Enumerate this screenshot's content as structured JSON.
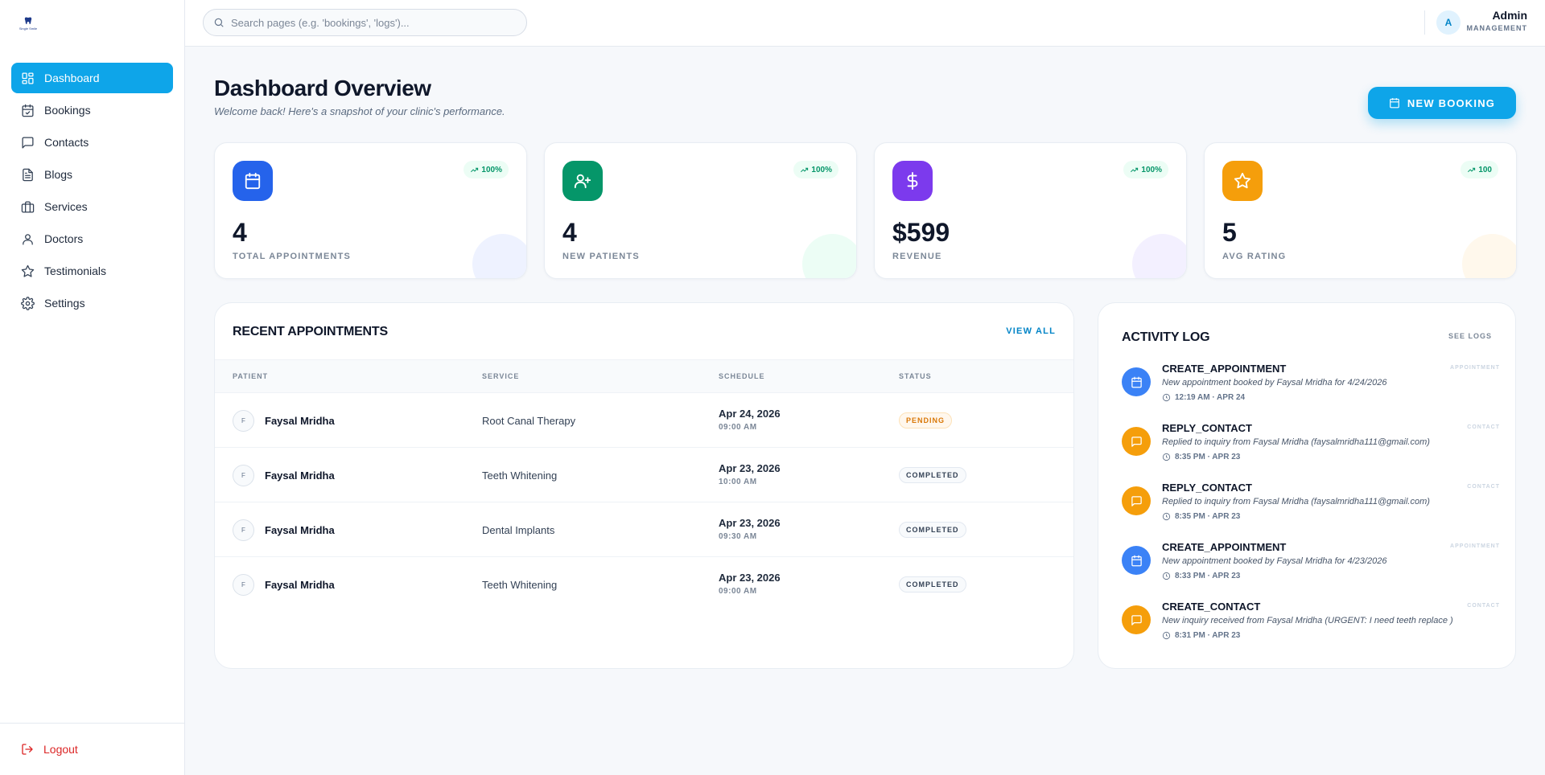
{
  "sidebar": {
    "logo_text": "Single Smile",
    "nav": [
      {
        "label": "Dashboard",
        "icon": "dashboard-icon",
        "active": true
      },
      {
        "label": "Bookings",
        "icon": "calendar-check-icon"
      },
      {
        "label": "Contacts",
        "icon": "message-square-icon"
      },
      {
        "label": "Blogs",
        "icon": "document-icon"
      },
      {
        "label": "Services",
        "icon": "briefcase-icon"
      },
      {
        "label": "Doctors",
        "icon": "user-icon"
      },
      {
        "label": "Testimonials",
        "icon": "star-icon"
      },
      {
        "label": "Settings",
        "icon": "gear-icon"
      }
    ],
    "logout_label": "Logout"
  },
  "topbar": {
    "search_placeholder": "Search pages (e.g. 'bookings', 'logs')...",
    "user_initial": "A",
    "user_name": "Admin",
    "user_role": "MANAGEMENT"
  },
  "header": {
    "title": "Dashboard Overview",
    "subtitle": "Welcome back! Here's a snapshot of your clinic's performance.",
    "new_booking_label": "NEW BOOKING"
  },
  "stats": [
    {
      "value": "4",
      "label": "TOTAL APPOINTMENTS",
      "trend": "100%",
      "icon": "calendar-icon",
      "color": "#2563eb",
      "blob": "#eef2ff"
    },
    {
      "value": "4",
      "label": "NEW PATIENTS",
      "trend": "100%",
      "icon": "user-plus-icon",
      "color": "#059669",
      "blob": "#ecfdf5"
    },
    {
      "value": "$599",
      "label": "REVENUE",
      "trend": "100%",
      "icon": "dollar-icon",
      "color": "#7c3aed",
      "blob": "#f3f0ff"
    },
    {
      "value": "5",
      "label": "AVG RATING",
      "trend": "100",
      "icon": "star-icon",
      "color": "#f59e0b",
      "blob": "#fff8ec"
    }
  ],
  "appointments": {
    "title": "RECENT APPOINTMENTS",
    "view_all": "VIEW ALL",
    "columns": [
      "PATIENT",
      "SERVICE",
      "SCHEDULE",
      "STATUS"
    ],
    "rows": [
      {
        "initial": "F",
        "patient": "Faysal Mridha",
        "service": "Root Canal Therapy",
        "date": "Apr 24, 2026",
        "time": "09:00 AM",
        "status": "PENDING"
      },
      {
        "initial": "F",
        "patient": "Faysal Mridha",
        "service": "Teeth Whitening",
        "date": "Apr 23, 2026",
        "time": "10:00 AM",
        "status": "COMPLETED"
      },
      {
        "initial": "F",
        "patient": "Faysal Mridha",
        "service": "Dental Implants",
        "date": "Apr 23, 2026",
        "time": "09:30 AM",
        "status": "COMPLETED"
      },
      {
        "initial": "F",
        "patient": "Faysal Mridha",
        "service": "Teeth Whitening",
        "date": "Apr 23, 2026",
        "time": "09:00 AM",
        "status": "COMPLETED"
      }
    ]
  },
  "activity": {
    "title": "ACTIVITY LOG",
    "see_logs": "SEE LOGS",
    "items": [
      {
        "action": "CREATE_APPOINTMENT",
        "tag": "APPOINTMENT",
        "desc": "New appointment booked by Faysal Mridha for 4/24/2026",
        "time": "12:19 AM · APR 24",
        "icon": "calendar-icon",
        "color": "#3b82f6"
      },
      {
        "action": "REPLY_CONTACT",
        "tag": "CONTACT",
        "desc": "Replied to inquiry from Faysal Mridha (faysalmridha111@gmail.com)",
        "time": "8:35 PM · APR 23",
        "icon": "message-icon",
        "color": "#f59e0b"
      },
      {
        "action": "REPLY_CONTACT",
        "tag": "CONTACT",
        "desc": "Replied to inquiry from Faysal Mridha (faysalmridha111@gmail.com)",
        "time": "8:35 PM · APR 23",
        "icon": "message-icon",
        "color": "#f59e0b"
      },
      {
        "action": "CREATE_APPOINTMENT",
        "tag": "APPOINTMENT",
        "desc": "New appointment booked by Faysal Mridha for 4/23/2026",
        "time": "8:33 PM · APR 23",
        "icon": "calendar-icon",
        "color": "#3b82f6"
      },
      {
        "action": "CREATE_CONTACT",
        "tag": "CONTACT",
        "desc": "New inquiry received from Faysal Mridha (URGENT: I need teeth replace )",
        "time": "8:31 PM · APR 23",
        "icon": "message-icon",
        "color": "#f59e0b"
      }
    ]
  }
}
